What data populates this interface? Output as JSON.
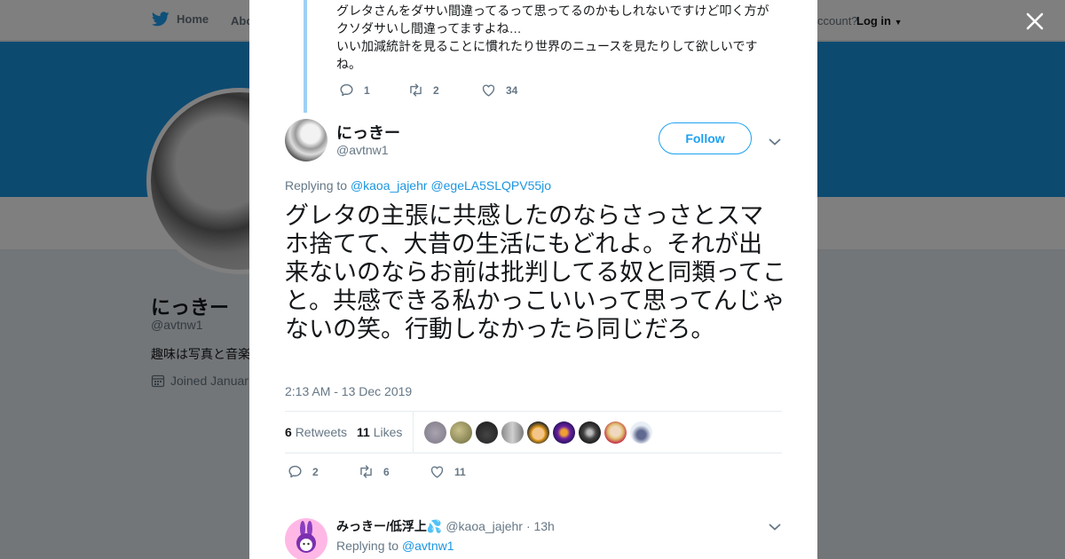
{
  "nav": {
    "home_label": "Home",
    "about_label": "Abo",
    "account_text": "ccount?",
    "login_label": "Log in"
  },
  "profile": {
    "name": "にっきー",
    "handle": "@avtnw1",
    "bio": "趣味は写真と音楽",
    "joined": "Joined Januar"
  },
  "previous_tweet": {
    "text": "グレタさんをダサい間違ってるって思ってるのかもしれないですけど叩く方がクソダサいし間違ってますよね…\nいい加減統計を見ることに慣れたり世界のニュースを見たりして欲しいですね。",
    "replies": "1",
    "retweets": "2",
    "likes": "34"
  },
  "tweet": {
    "author_name": "にっきー",
    "author_handle": "@avtnw1",
    "follow_label": "Follow",
    "replying_prefix": "Replying to",
    "replying_to_1": "@kaoa_jajehr",
    "replying_to_2": "@egeLA5SLQPV55jo",
    "text": "グレタの主張に共感したのならさっさとスマホ捨てて、大昔の生活にもどれよ。それが出来ないのならお前は批判してる奴と同類ってこと。共感できる私かっこいいって思ってんじゃないの笑。行動しなかったら同じだろ。",
    "timestamp": "2:13 AM - 13 Dec 2019",
    "retweet_count": "6",
    "retweet_label": "Retweets",
    "like_count": "11",
    "like_label": "Likes",
    "replies": "2",
    "retweets": "6",
    "likes": "11"
  },
  "reply": {
    "author_name": "みっきー/低浮上💦",
    "author_handle": "@kaoa_jajehr",
    "time": "· 13h",
    "replying_prefix": "Replying to",
    "replying_to": "@avtnw1"
  },
  "colors": {
    "accent": "#1da1f2",
    "link": "#1b95e0",
    "banner": "#1b95e0",
    "thread_line": "#9ed1f4"
  },
  "icons": [
    "twitter-bird-icon",
    "close-icon",
    "reply-icon",
    "retweet-icon",
    "like-icon",
    "chevron-down-icon",
    "calendar-icon"
  ]
}
